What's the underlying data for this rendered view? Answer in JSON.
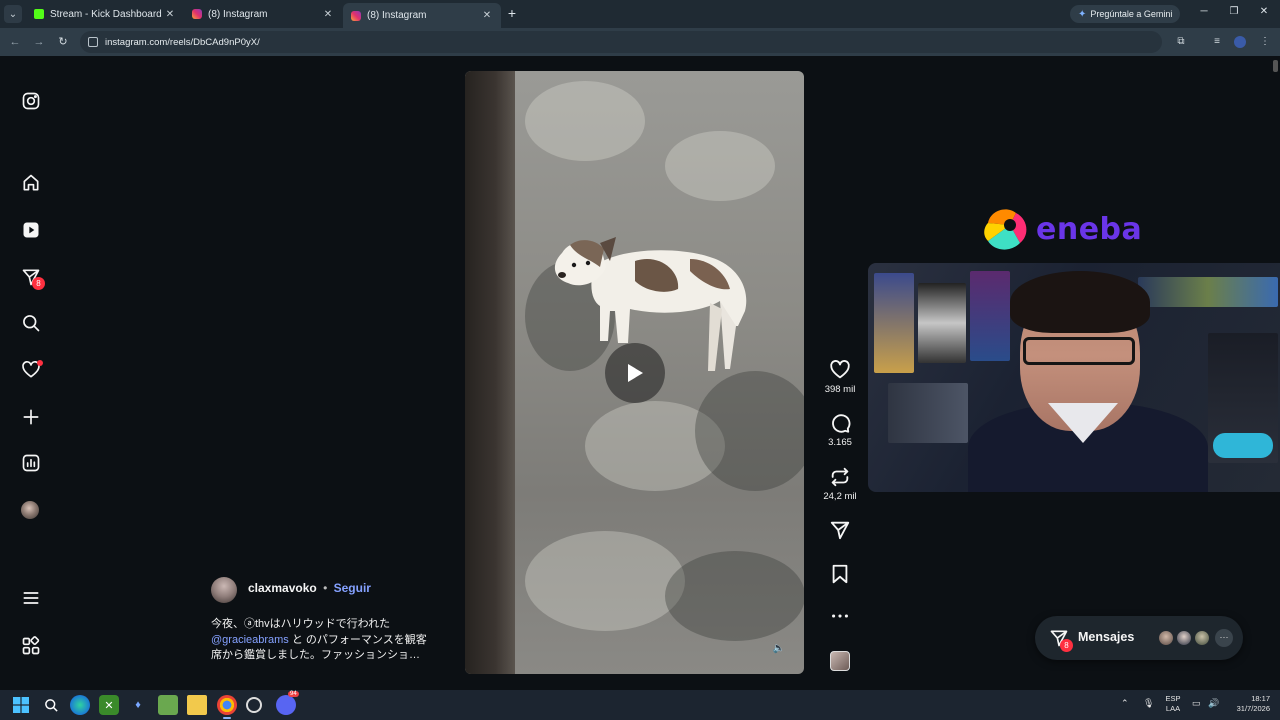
{
  "browser": {
    "tabs": [
      {
        "title": "Stream - Kick Dashboard",
        "icon": "kick-icon",
        "active": false
      },
      {
        "title": "(8) Instagram",
        "icon": "instagram-icon",
        "active": false
      },
      {
        "title": "(8) Instagram",
        "icon": "instagram-icon",
        "active": true
      }
    ],
    "new_tab": "+",
    "gemini_label": "Pregúntale a Gemini",
    "url": "instagram.com/reels/DbCAd9nP0yX/"
  },
  "sidebar": {
    "items": [
      {
        "name": "instagram-logo-icon"
      },
      {
        "name": "home-icon"
      },
      {
        "name": "reels-icon"
      },
      {
        "name": "messages-icon",
        "badge": "8"
      },
      {
        "name": "search-icon"
      },
      {
        "name": "notifications-icon"
      },
      {
        "name": "create-icon"
      },
      {
        "name": "dashboard-icon"
      },
      {
        "name": "profile-avatar"
      },
      {
        "name": "menu-icon"
      },
      {
        "name": "also-from-meta-icon"
      }
    ]
  },
  "reel": {
    "likes": "398 mil",
    "comments": "3.165",
    "reposts": "24,2 mil",
    "author": "claxmavoko",
    "separator": "•",
    "follow_label": "Seguir",
    "caption_line1": "今夜、ⓐthvはハリウッドで行われた",
    "caption_mention": "@gracieabrams",
    "caption_line2_rest": " と のパフォーマンスを観客",
    "caption_line3": "席から鑑賞しました。ファッションショ…"
  },
  "overlay": {
    "sponsor": "eneba"
  },
  "messages": {
    "label": "Mensajes",
    "badge": "8",
    "more": "···"
  },
  "taskbar": {
    "lang_top": "ESP",
    "lang_bottom": "LAA",
    "time": "18:17",
    "date": "31/7/2026",
    "discord_badge": "94"
  },
  "colors": {
    "page_bg": "#0c1014",
    "link_blue": "#85a1ff",
    "notification_red": "#ff3040",
    "eneba_purple": "#6a35e8"
  }
}
